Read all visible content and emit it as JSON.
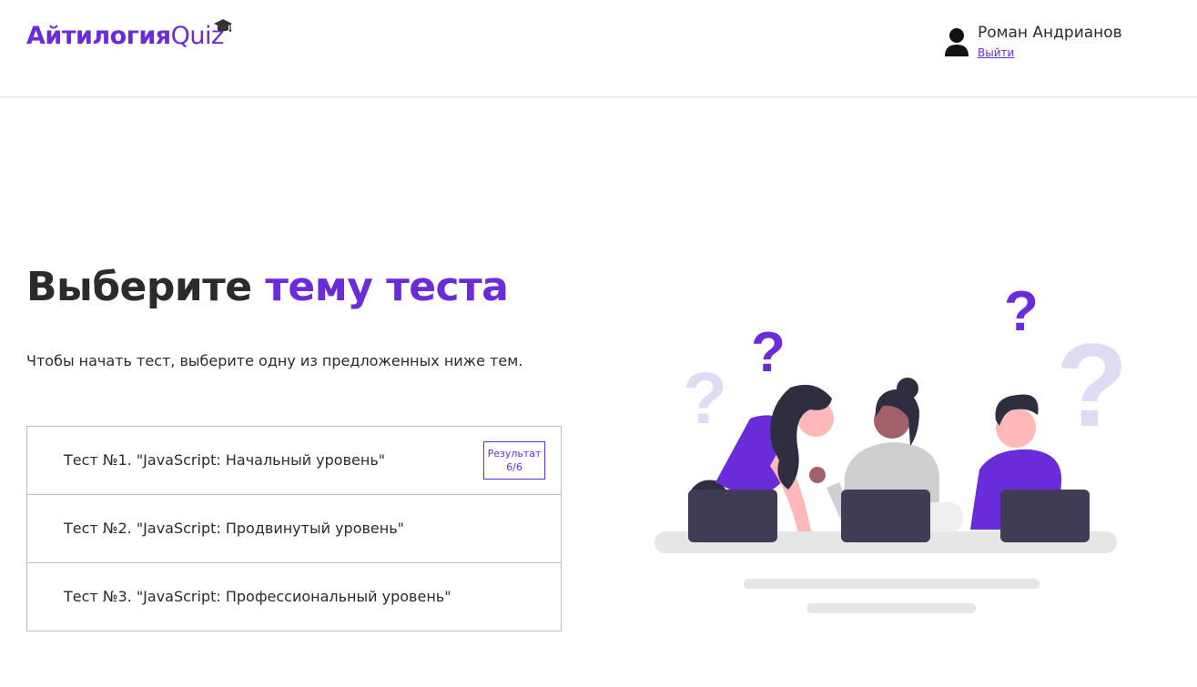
{
  "header": {
    "logo_main": "Айтилогия",
    "logo_quiz": "Quiz",
    "user": {
      "name": "Роман Андрианов",
      "logout_label": "Выйти"
    }
  },
  "main": {
    "title_part1": "Выберите",
    "title_part2": "тему теста",
    "subtitle": "Чтобы начать тест, выберите одну из предложенных ниже тем.",
    "tests": [
      {
        "label": "Тест №1. \"JavaScript: Начальный уровень\"",
        "result_label": "Результат",
        "result_value": "6/6"
      },
      {
        "label": "Тест №2. \"JavaScript: Продвинутый уровень\""
      },
      {
        "label": "Тест №3. \"JavaScript: Профессиональный уровень\""
      }
    ]
  },
  "colors": {
    "accent": "#6a2bd9",
    "text": "#2b2b2b",
    "border": "#bdbdbd"
  },
  "icons": {
    "logo_decoration": "graduation-cap-icon",
    "user_avatar": "user-icon"
  }
}
